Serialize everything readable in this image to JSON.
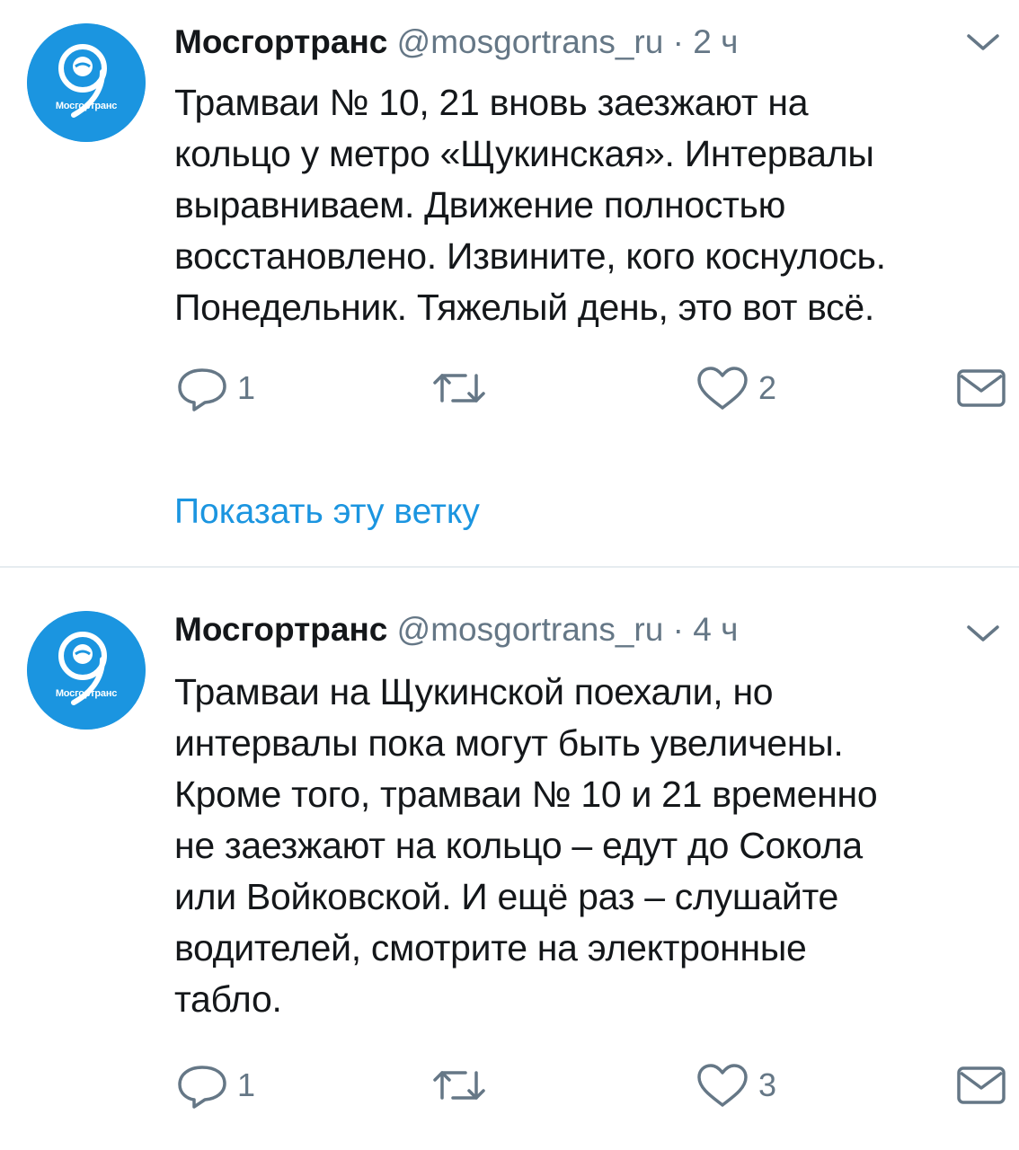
{
  "accent_color": "#1b95e0",
  "tweets": [
    {
      "name": "Мосгортранс",
      "handle": "@mosgortrans_ru",
      "separator": "·",
      "time": "2 ч",
      "avatar_label": "Мосгортранс",
      "text": "Трамваи № 10, 21 вновь заезжают на\nкольцо у метро «Щукинская». Интервалы\nвыравниваем. Движение полностью\nвосстановлено. Извините, кого коснулось.\nПонедельник. Тяжелый день, это вот всё.",
      "reply_count": "1",
      "retweet_count": "",
      "like_count": "2",
      "show_thread": "Показать эту ветку"
    },
    {
      "name": "Мосгортранс",
      "handle": "@mosgortrans_ru",
      "separator": "·",
      "time": "4 ч",
      "avatar_label": "Мосгортранс",
      "text": "Трамваи на Щукинской поехали, но\nинтервалы пока могут быть увеличены.\nКроме того, трамваи № 10 и 21 временно\nне заезжают на кольцо – едут до Сокола\nили Войковской. И ещё раз – слушайте\nводителей, смотрите на электронные\nтабло.",
      "reply_count": "1",
      "retweet_count": "",
      "like_count": "3"
    }
  ],
  "icons": {
    "reply": "reply-icon",
    "retweet": "retweet-icon",
    "like": "heart-icon",
    "dm": "direct-message-icon",
    "caret": "chevron-down-icon",
    "avatar": "mosgortrans-logo"
  }
}
